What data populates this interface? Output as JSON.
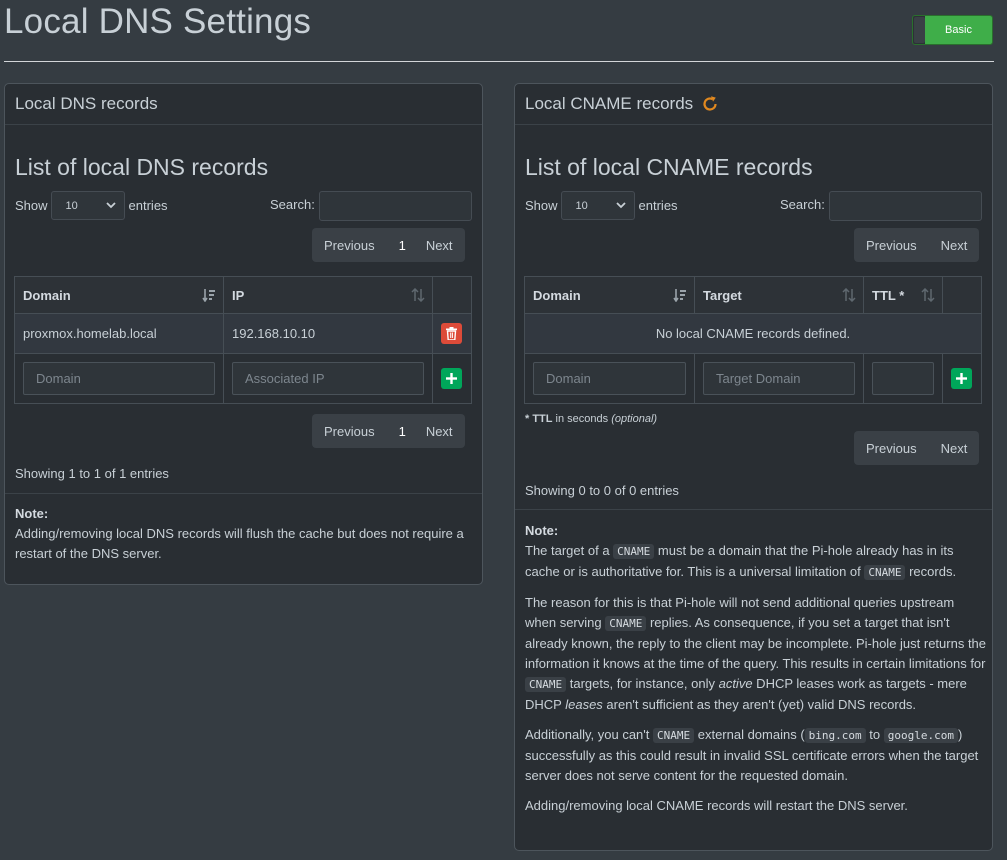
{
  "page": {
    "title": "Local DNS Settings",
    "mode_button": "Basic"
  },
  "dns": {
    "panel_title": "Local DNS records",
    "list_title": "List of local DNS records",
    "show_label": "Show",
    "entries_label": "entries",
    "page_size": "10",
    "search_label": "Search:",
    "pager": {
      "prev": "Previous",
      "page": "1",
      "next": "Next"
    },
    "columns": [
      "Domain",
      "IP"
    ],
    "rows": [
      {
        "domain": "proxmox.homelab.local",
        "ip": "192.168.10.10"
      }
    ],
    "placeholders": {
      "domain": "Domain",
      "ip": "Associated IP"
    },
    "info": "Showing 1 to 1 of 1 entries",
    "note_title": "Note:",
    "note_text": "Adding/removing local DNS records will flush the cache but does not require a restart of the DNS server."
  },
  "cname": {
    "panel_title": "Local CNAME records",
    "list_title": "List of local CNAME records",
    "show_label": "Show",
    "entries_label": "entries",
    "page_size": "10",
    "search_label": "Search:",
    "pager": {
      "prev": "Previous",
      "next": "Next"
    },
    "columns": [
      "Domain",
      "Target",
      "TTL *"
    ],
    "empty_text": "No local CNAME records defined.",
    "placeholders": {
      "domain": "Domain",
      "target": "Target Domain"
    },
    "ttl_prefix": "* TTL",
    "ttl_text": " in seconds ",
    "ttl_optional": "(optional)",
    "info": "Showing 0 to 0 of 0 entries",
    "note_title": "Note:",
    "code_cname": "CNAME",
    "code_bing": "bing.com",
    "code_google": "google.com",
    "p1": [
      "The target of a ",
      " must be a domain that the Pi-hole already has in its cache or is authoritative for. This is a universal limitation of ",
      " records."
    ],
    "p2": [
      "The reason for this is that Pi-hole will not send additional queries upstream when serving ",
      " replies. As consequence, if you set a target that isn't already known, the reply to the client may be incomplete. Pi-hole just returns the information it knows at the time of the query. This results in certain limitations for ",
      " targets, for instance, only ",
      "active",
      " DHCP leases work as targets - mere DHCP ",
      "leases",
      " aren't sufficient as they aren't (yet) valid DNS records."
    ],
    "p3": [
      "Additionally, you can't ",
      " external domains (",
      " to ",
      ") successfully as this could result in invalid SSL certificate errors when the target server does not serve content for the requested domain."
    ],
    "p4": "Adding/removing local CNAME records will restart the DNS server."
  },
  "colors": {
    "background": "#353c42",
    "panel": "#292e33",
    "delete": "#dd4b39",
    "add": "#00a65a",
    "refresh": "#e0881f",
    "toggle": "#3fae49"
  }
}
